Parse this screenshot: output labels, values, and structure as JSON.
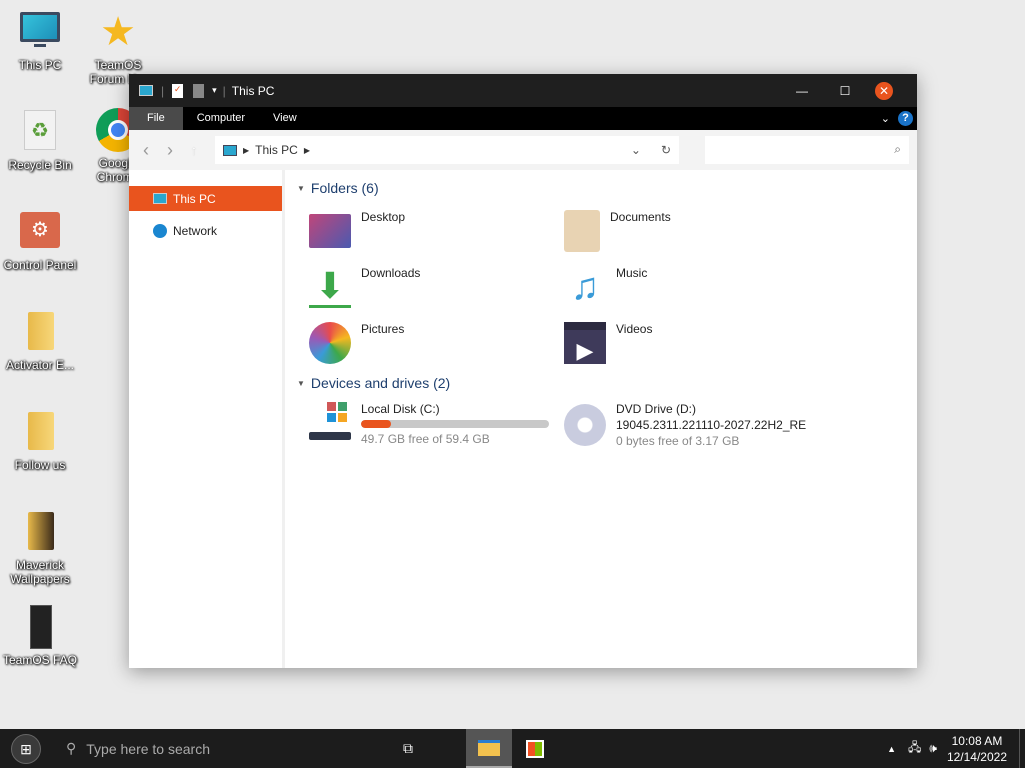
{
  "desktop": {
    "icons": [
      "This PC",
      "TeamOS Forum H...",
      "Recycle Bin",
      "Google Chrome",
      "Control Panel",
      "Activator E...",
      "Follow us",
      "Maverick Wallpapers",
      "TeamOS FAQ"
    ]
  },
  "window": {
    "title": "This PC",
    "ribbon": [
      "File",
      "Computer",
      "View"
    ],
    "address": "This PC",
    "sidebar": [
      "This PC",
      "Network"
    ],
    "folders_header": "Folders (6)",
    "folders": [
      "Desktop",
      "Documents",
      "Downloads",
      "Music",
      "Pictures",
      "Videos"
    ],
    "drives_header": "Devices and drives (2)",
    "drives": [
      {
        "name": "Local Disk (C:)",
        "free": "49.7 GB free of 59.4 GB",
        "used_fraction": 0.16
      },
      {
        "name": "DVD Drive (D:)",
        "label": "19045.2311.221110-2027.22H2_RE",
        "free": "0 bytes free of 3.17 GB"
      }
    ]
  },
  "taskbar": {
    "search_placeholder": "Type here to search",
    "time": "10:08 AM",
    "date": "12/14/2022"
  },
  "colors": {
    "accent": "#e9541e"
  }
}
